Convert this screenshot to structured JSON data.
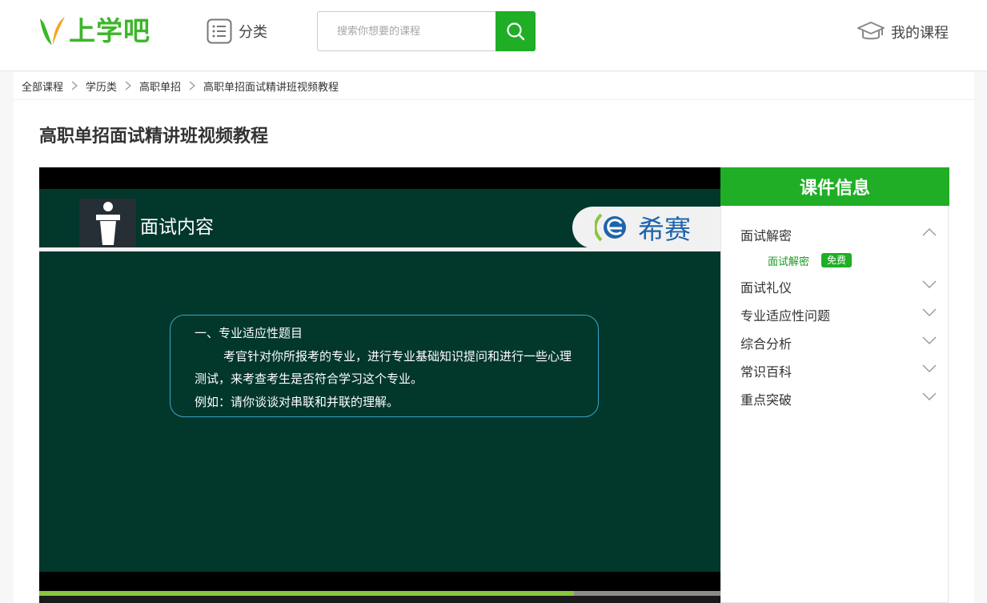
{
  "header": {
    "logo_text": "上学吧",
    "category_label": "分类",
    "search_placeholder": "搜索你想要的课程",
    "my_courses_label": "我的课程",
    "accent_color": "#1fae25"
  },
  "breadcrumb": [
    "全部课程",
    "学历类",
    "高职单招",
    "高职单招面试精讲班视频教程"
  ],
  "page_title": "高职单招面试精讲班视频教程",
  "video": {
    "slide_title": "面试内容",
    "brand_text": "希赛",
    "content": {
      "heading": "一、专业适应性题目",
      "body": "考官针对你所报考的专业，进行专业基础知识提问和进行一些心理测试，来考查考生是否符合学习这个专业。",
      "example": "例如：请你谈谈对串联和并联的理解。"
    },
    "progress_fraction": 0.785
  },
  "sidebar": {
    "title": "课件信息",
    "chapters": [
      {
        "label": "面试解密",
        "expanded": true,
        "lessons": [
          {
            "label": "面试解密",
            "badge": "免费"
          }
        ]
      },
      {
        "label": "面试礼仪",
        "expanded": false
      },
      {
        "label": "专业适应性问题",
        "expanded": false
      },
      {
        "label": "综合分析",
        "expanded": false
      },
      {
        "label": "常识百科",
        "expanded": false
      },
      {
        "label": "重点突破",
        "expanded": false
      }
    ]
  }
}
